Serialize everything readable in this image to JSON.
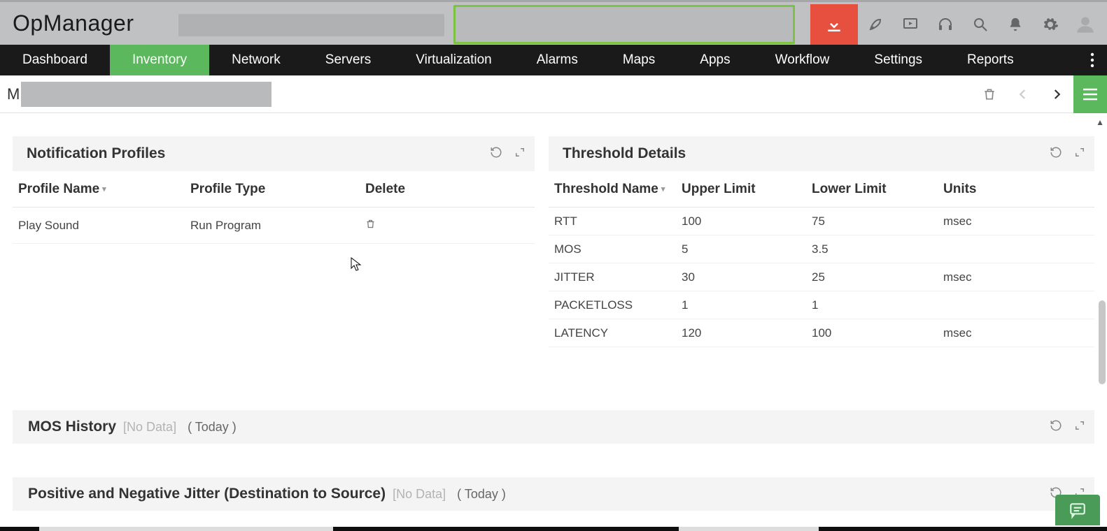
{
  "brand": "OpManager",
  "nav": {
    "items": [
      "Dashboard",
      "Inventory",
      "Network",
      "Servers",
      "Virtualization",
      "Alarms",
      "Maps",
      "Apps",
      "Workflow",
      "Settings",
      "Reports"
    ],
    "active_index": 1
  },
  "subbar": {
    "letter": "M"
  },
  "panels": {
    "notification_profiles": {
      "title": "Notification Profiles",
      "columns": [
        "Profile Name",
        "Profile Type",
        "Delete"
      ],
      "rows": [
        {
          "name": "Play Sound",
          "type": "Run Program"
        }
      ]
    },
    "threshold_details": {
      "title": "Threshold Details",
      "columns": [
        "Threshold Name",
        "Upper Limit",
        "Lower Limit",
        "Units"
      ],
      "rows": [
        {
          "name": "RTT",
          "upper": "100",
          "lower": "75",
          "units": "msec"
        },
        {
          "name": "MOS",
          "upper": "5",
          "lower": "3.5",
          "units": ""
        },
        {
          "name": "JITTER",
          "upper": "30",
          "lower": "25",
          "units": "msec"
        },
        {
          "name": "PACKETLOSS",
          "upper": "1",
          "lower": "1",
          "units": ""
        },
        {
          "name": "LATENCY",
          "upper": "120",
          "lower": "100",
          "units": "msec"
        }
      ]
    },
    "mos_history": {
      "title": "MOS History",
      "nodata": "[No Data]",
      "period": "( Today )"
    },
    "jitter_ds": {
      "title": "Positive and Negative Jitter (Destination to Source)",
      "nodata": "[No Data]",
      "period": "( Today )"
    }
  }
}
